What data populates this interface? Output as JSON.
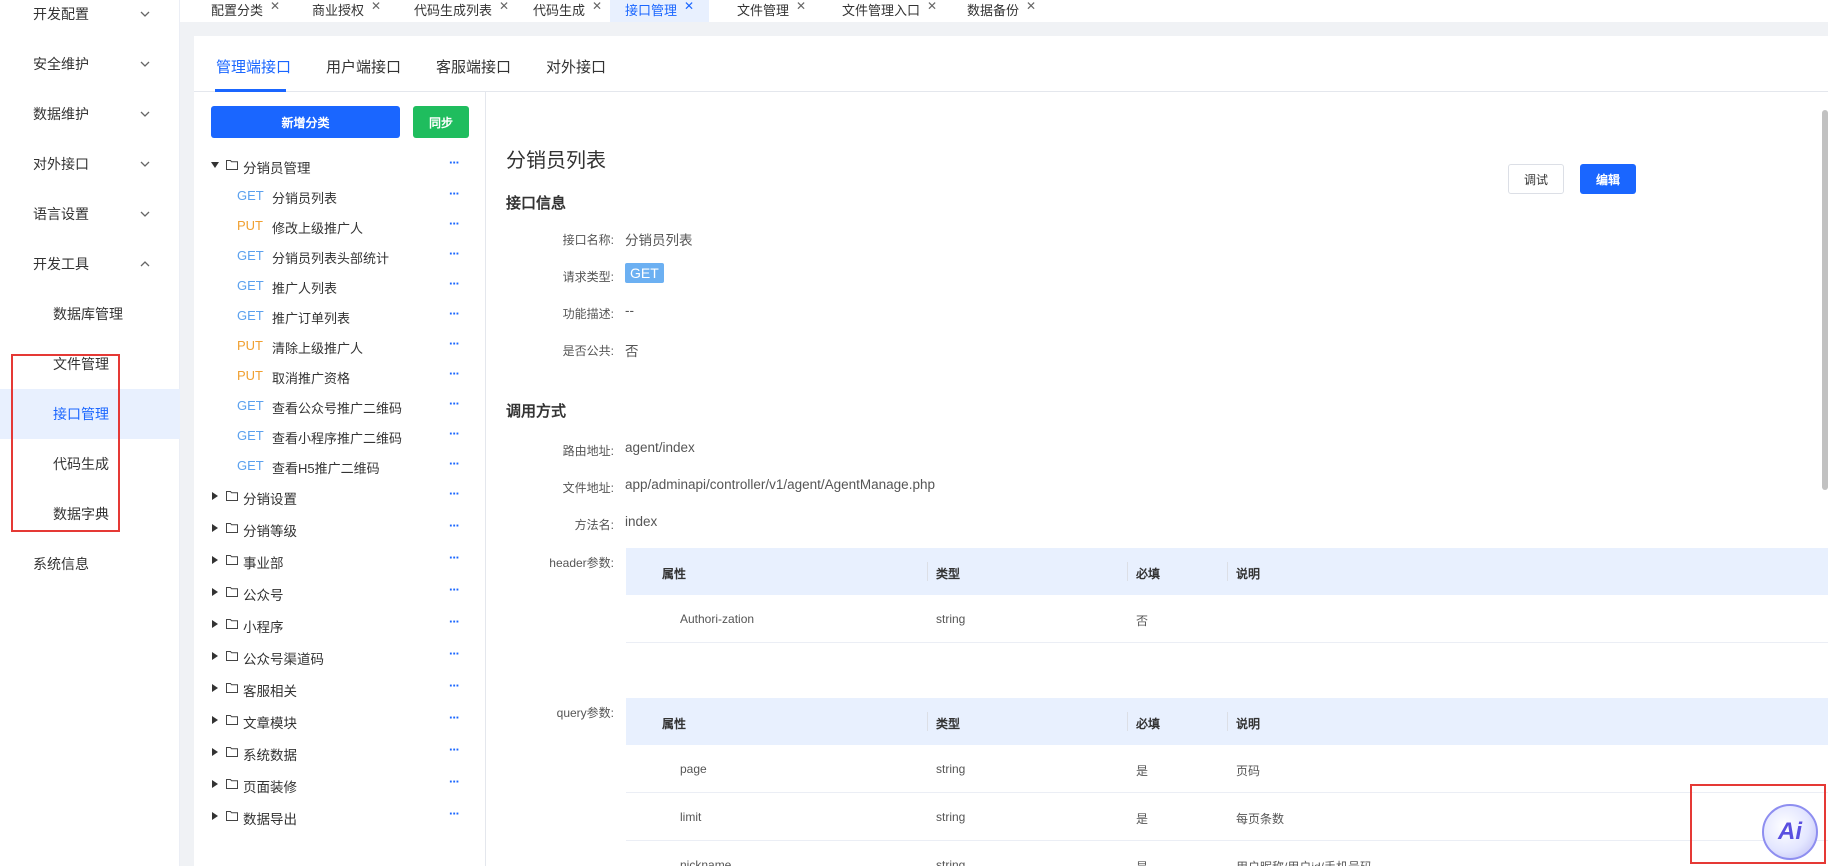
{
  "sidebar": {
    "items": [
      {
        "label": "开发配置",
        "expandable": true,
        "expanded": false
      },
      {
        "label": "安全维护",
        "expandable": true,
        "expanded": false
      },
      {
        "label": "数据维护",
        "expandable": true,
        "expanded": false
      },
      {
        "label": "对外接口",
        "expandable": true,
        "expanded": false
      },
      {
        "label": "语言设置",
        "expandable": true,
        "expanded": false
      },
      {
        "label": "开发工具",
        "expandable": true,
        "expanded": true
      },
      {
        "label": "数据库管理",
        "sub": true
      },
      {
        "label": "文件管理",
        "sub": true
      },
      {
        "label": "接口管理",
        "sub": true,
        "active": true
      },
      {
        "label": "代码生成",
        "sub": true
      },
      {
        "label": "数据字典",
        "sub": true
      },
      {
        "label": "系统信息"
      }
    ]
  },
  "tabs": [
    {
      "label": "配置分类"
    },
    {
      "label": "商业授权"
    },
    {
      "label": "代码生成列表"
    },
    {
      "label": "代码生成"
    },
    {
      "label": "接口管理",
      "active": true
    },
    {
      "label": "文件管理"
    },
    {
      "label": "文件管理入口"
    },
    {
      "label": "数据备份"
    }
  ],
  "subtabs": [
    {
      "label": "管理端接口",
      "active": true
    },
    {
      "label": "用户端接口"
    },
    {
      "label": "客服端接口"
    },
    {
      "label": "对外接口"
    }
  ],
  "tree": {
    "add_label": "新增分类",
    "sync_label": "同步",
    "more_glyph": "···",
    "nodes": [
      {
        "type": "folder",
        "label": "分销员管理",
        "expanded": true
      },
      {
        "type": "leaf",
        "method": "GET",
        "label": "分销员列表"
      },
      {
        "type": "leaf",
        "method": "PUT",
        "label": "修改上级推广人"
      },
      {
        "type": "leaf",
        "method": "GET",
        "label": "分销员列表头部统计"
      },
      {
        "type": "leaf",
        "method": "GET",
        "label": "推广人列表"
      },
      {
        "type": "leaf",
        "method": "GET",
        "label": "推广订单列表"
      },
      {
        "type": "leaf",
        "method": "PUT",
        "label": "清除上级推广人"
      },
      {
        "type": "leaf",
        "method": "PUT",
        "label": "取消推广资格"
      },
      {
        "type": "leaf",
        "method": "GET",
        "label": "查看公众号推广二维码"
      },
      {
        "type": "leaf",
        "method": "GET",
        "label": "查看小程序推广二维码"
      },
      {
        "type": "leaf",
        "method": "GET",
        "label": "查看H5推广二维码"
      },
      {
        "type": "folder",
        "label": "分销设置"
      },
      {
        "type": "folder",
        "label": "分销等级"
      },
      {
        "type": "folder",
        "label": "事业部"
      },
      {
        "type": "folder",
        "label": "公众号"
      },
      {
        "type": "folder",
        "label": "小程序"
      },
      {
        "type": "folder",
        "label": "公众号渠道码"
      },
      {
        "type": "folder",
        "label": "客服相关"
      },
      {
        "type": "folder",
        "label": "文章模块"
      },
      {
        "type": "folder",
        "label": "系统数据"
      },
      {
        "type": "folder",
        "label": "页面装修"
      },
      {
        "type": "folder",
        "label": "数据导出"
      }
    ]
  },
  "detail": {
    "title": "分销员列表",
    "debug_label": "调试",
    "edit_label": "编辑",
    "info_section": "接口信息",
    "call_section": "调用方式",
    "fields": {
      "name_label": "接口名称:",
      "name_value": "分销员列表",
      "method_label": "请求类型:",
      "method_value": "GET",
      "desc_label": "功能描述:",
      "desc_value": "--",
      "public_label": "是否公共:",
      "public_value": "否",
      "route_label": "路由地址:",
      "route_value": "agent/index",
      "file_label": "文件地址:",
      "file_value": "app/adminapi/controller/v1/agent/AgentManage.php",
      "func_label": "方法名:",
      "func_value": "index"
    },
    "header_params": {
      "label": "header参数:",
      "columns": [
        "属性",
        "类型",
        "必填",
        "说明"
      ],
      "rows": [
        [
          "Authori-zation",
          "string",
          "否",
          ""
        ]
      ]
    },
    "query_params": {
      "label": "query参数:",
      "columns": [
        "属性",
        "类型",
        "必填",
        "说明"
      ],
      "rows": [
        [
          "page",
          "string",
          "是",
          "页码"
        ],
        [
          "limit",
          "string",
          "是",
          "每页条数"
        ],
        [
          "nickname",
          "string",
          "是",
          "用户昵称/用户id/手机号码"
        ]
      ]
    }
  },
  "ai_button": {
    "label": "Ai"
  },
  "colors": {
    "primary": "#1a66ff",
    "success": "#1fbd5e",
    "get": "#5aa0ee",
    "put": "#f0a030",
    "highlight": "#e53935"
  }
}
